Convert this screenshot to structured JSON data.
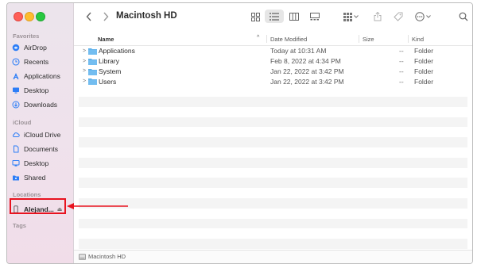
{
  "window": {
    "title": "Macintosh HD"
  },
  "sidebar": {
    "favorites_label": "Favorites",
    "favorites": [
      {
        "label": "AirDrop",
        "icon": "airdrop-icon"
      },
      {
        "label": "Recents",
        "icon": "clock-icon"
      },
      {
        "label": "Applications",
        "icon": "applications-icon"
      },
      {
        "label": "Desktop",
        "icon": "desktop-icon"
      },
      {
        "label": "Downloads",
        "icon": "download-icon"
      }
    ],
    "icloud_label": "iCloud",
    "icloud": [
      {
        "label": "iCloud Drive",
        "icon": "cloud-icon"
      },
      {
        "label": "Documents",
        "icon": "document-icon"
      },
      {
        "label": "Desktop",
        "icon": "desktop-icon"
      },
      {
        "label": "Shared",
        "icon": "shared-folder-icon"
      }
    ],
    "locations_label": "Locations",
    "locations": [
      {
        "label": "Alejand...",
        "icon": "iphone-icon"
      }
    ],
    "tags_label": "Tags"
  },
  "columns": {
    "name": "Name",
    "date": "Date Modified",
    "size": "Size",
    "kind": "Kind"
  },
  "rows": [
    {
      "name": "Applications",
      "date": "Today at 10:31 AM",
      "size": "--",
      "kind": "Folder"
    },
    {
      "name": "Library",
      "date": "Feb 8, 2022 at 4:34 PM",
      "size": "--",
      "kind": "Folder"
    },
    {
      "name": "System",
      "date": "Jan 22, 2022 at 3:42 PM",
      "size": "--",
      "kind": "Folder"
    },
    {
      "name": "Users",
      "date": "Jan 22, 2022 at 3:42 PM",
      "size": "--",
      "kind": "Folder"
    }
  ],
  "status": {
    "path": "Macintosh HD"
  },
  "colors": {
    "folder": "#5aaee8",
    "highlight": "#e8131f",
    "accent": "#2d7ef7"
  }
}
